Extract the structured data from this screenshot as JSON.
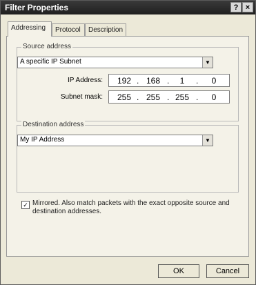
{
  "window": {
    "title": "Filter Properties",
    "help": "?",
    "close": "×"
  },
  "tabs": [
    "Addressing",
    "Protocol",
    "Description"
  ],
  "source": {
    "group_label": "Source address",
    "type": "A specific IP Subnet",
    "ip_label": "IP Address:",
    "ip": [
      "192",
      "168",
      "1",
      "0"
    ],
    "mask_label": "Subnet mask:",
    "mask": [
      "255",
      "255",
      "255",
      "0"
    ]
  },
  "destination": {
    "group_label": "Destination address",
    "type": "My IP Address"
  },
  "mirrored": {
    "checked": true,
    "mark": "✓",
    "label": "Mirrored. Also match packets with the exact opposite source and destination addresses."
  },
  "buttons": {
    "ok": "OK",
    "cancel": "Cancel"
  }
}
